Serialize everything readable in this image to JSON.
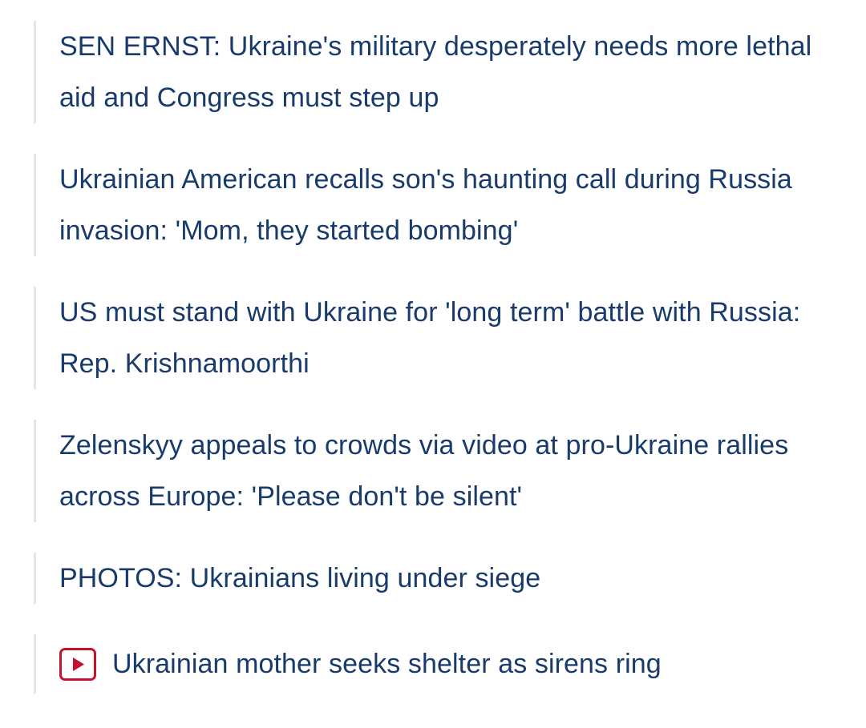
{
  "related": {
    "items": [
      {
        "title": "SEN ERNST: Ukraine's military desperately needs more lethal aid and Congress must step up",
        "video": false
      },
      {
        "title": "Ukrainian American recalls son's haunting call during Russia invasion: 'Mom, they started bombing'",
        "video": false
      },
      {
        "title": "US must stand with Ukraine for 'long term' battle with Russia: Rep. Krishnamoorthi",
        "video": false
      },
      {
        "title": "Zelenskyy appeals to crowds via video at pro-Ukraine rallies across Europe: 'Please don't be silent'",
        "video": false
      },
      {
        "title": "PHOTOS: Ukrainians living under siege",
        "video": false
      },
      {
        "title": "Ukrainian mother seeks shelter as sirens ring",
        "video": true,
        "icon": "video-play-icon"
      }
    ]
  },
  "colors": {
    "link": "#183b6b",
    "border": "#e2e6ea",
    "video_accent": "#c8102e"
  }
}
